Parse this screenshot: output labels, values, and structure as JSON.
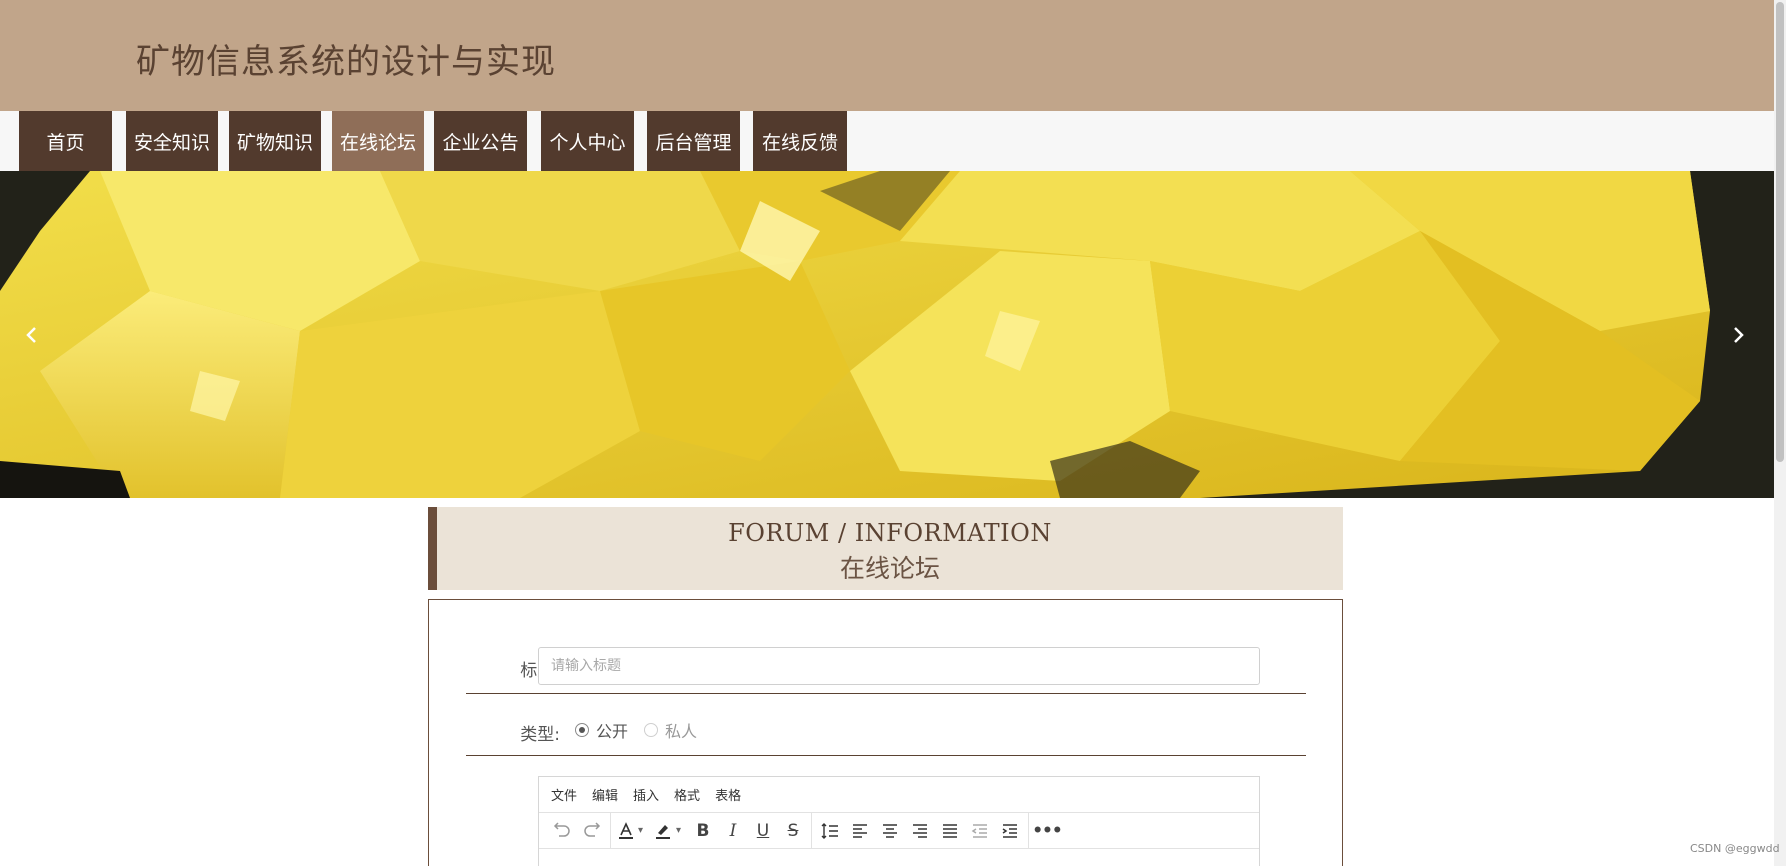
{
  "header": {
    "site_title": "矿物信息系统的设计与实现"
  },
  "nav": {
    "items": [
      {
        "label": "首页"
      },
      {
        "label": "安全知识"
      },
      {
        "label": "矿物知识"
      },
      {
        "label": "在线论坛",
        "active": true
      },
      {
        "label": "企业公告"
      },
      {
        "label": "个人中心"
      },
      {
        "label": "后台管理"
      },
      {
        "label": "在线反馈"
      }
    ]
  },
  "banner": {
    "prev_icon": "chevron-left-icon",
    "next_icon": "chevron-right-icon"
  },
  "section": {
    "title_en": "FORUM / INFORMATION",
    "title_cn": "在线论坛"
  },
  "form": {
    "title_label": "标题:",
    "title_placeholder": "请输入标题",
    "type_label": "类型:",
    "type_options": [
      {
        "label": "公开",
        "selected": true
      },
      {
        "label": "私人",
        "selected": false
      }
    ]
  },
  "editor": {
    "menus": [
      "文件",
      "编辑",
      "插入",
      "格式",
      "表格"
    ],
    "toolbar_icons": [
      "undo-icon",
      "redo-icon",
      "text-color-icon",
      "highlight-icon",
      "bold-icon",
      "italic-icon",
      "underline-icon",
      "strikethrough-icon",
      "line-height-icon",
      "align-left-icon",
      "align-center-icon",
      "align-right-icon",
      "align-justify-icon",
      "outdent-icon",
      "indent-icon",
      "more-icon"
    ]
  },
  "watermark": "CSDN @eggwdd",
  "colors": {
    "header_bg": "#c1a58a",
    "nav_bg": "#523a2d",
    "nav_active": "#8f6e58",
    "accent": "#6b4e3b"
  }
}
